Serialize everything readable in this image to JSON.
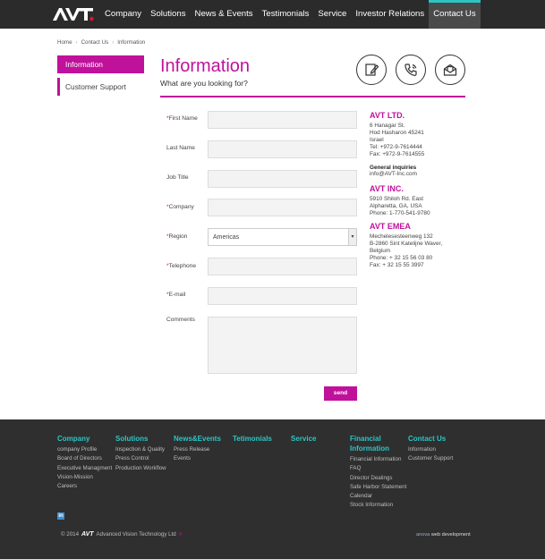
{
  "nav": {
    "logo": "AVT",
    "items": [
      "Company",
      "Solutions",
      "News & Events",
      "Testimonials",
      "Service",
      "Investor Relations",
      "Contact Us"
    ],
    "active": "Contact Us"
  },
  "breadcrumb": [
    "Home",
    "Contact Us",
    "Information"
  ],
  "sidebar": {
    "items": [
      "Information",
      "Customer Support"
    ]
  },
  "main": {
    "title": "Information",
    "subtitle": "What are you looking for?"
  },
  "form": {
    "fields": [
      {
        "label": "First Name",
        "required": true
      },
      {
        "label": "Last Name",
        "required": false
      },
      {
        "label": "Job Title",
        "required": false
      },
      {
        "label": "Company",
        "required": true
      },
      {
        "label": "Region",
        "required": true,
        "value": "Americas"
      },
      {
        "label": "Telephone",
        "required": true
      },
      {
        "label": "E-mail",
        "required": true
      },
      {
        "label": "Comments",
        "required": false
      }
    ],
    "send_label": "send"
  },
  "contacts": {
    "ltd": {
      "name": "AVT LTD.",
      "lines": [
        "6 Hanagar St.",
        "Hod Hasharon 45241",
        "Israel",
        "Tel: +972-9-7614444",
        "Fax: +972-9-7614555"
      ]
    },
    "general": {
      "heading": "General inquiries",
      "email": "info@AVT-Inc.com"
    },
    "inc": {
      "name": "AVT INC.",
      "lines": [
        "5910 Shiloh Rd. East",
        "Alpharetta, GA, USA",
        "Phone: 1-770-541-9780"
      ]
    },
    "emea": {
      "name": "AVT EMEA",
      "lines": [
        "Mechelesesteenweg 132",
        "B-2860 Sint Katelijne Waver,",
        "Belgium",
        "Phone: + 32 15 56 03 80",
        "Fax: + 32 15 55 3997"
      ]
    }
  },
  "footer": {
    "columns": [
      {
        "title": "Company",
        "links": [
          "company Profile",
          "Board of Directors",
          "Executive Managment",
          "Vision-Mission",
          "Careers"
        ]
      },
      {
        "title": "Solutions",
        "links": [
          "Inspection & Quality",
          "Press Control",
          "Production Workflow"
        ]
      },
      {
        "title": "News&Events",
        "links": [
          "Press Release",
          "Events"
        ]
      },
      {
        "title": "Tetimonials",
        "links": []
      },
      {
        "title": "Service",
        "links": []
      },
      {
        "title": "Financial Information",
        "links": [
          "Financial Information",
          "FAQ",
          "Director Dealings",
          "Safe Harbor Statement",
          "Calendar",
          "Stock Information"
        ]
      },
      {
        "title": "Contact Us",
        "links": [
          "Information",
          "Customer Support"
        ]
      }
    ],
    "social": "in",
    "copyright_year": "© 2014",
    "copyright_logo": "AVT",
    "copyright_text": "Advanced Vision Technology Ltd",
    "credit_prefix": "anova",
    "credit_text": "web development"
  },
  "colors": {
    "accent": "#c0119b",
    "teal": "#2ec4c4",
    "dark": "#2b2b2b"
  }
}
